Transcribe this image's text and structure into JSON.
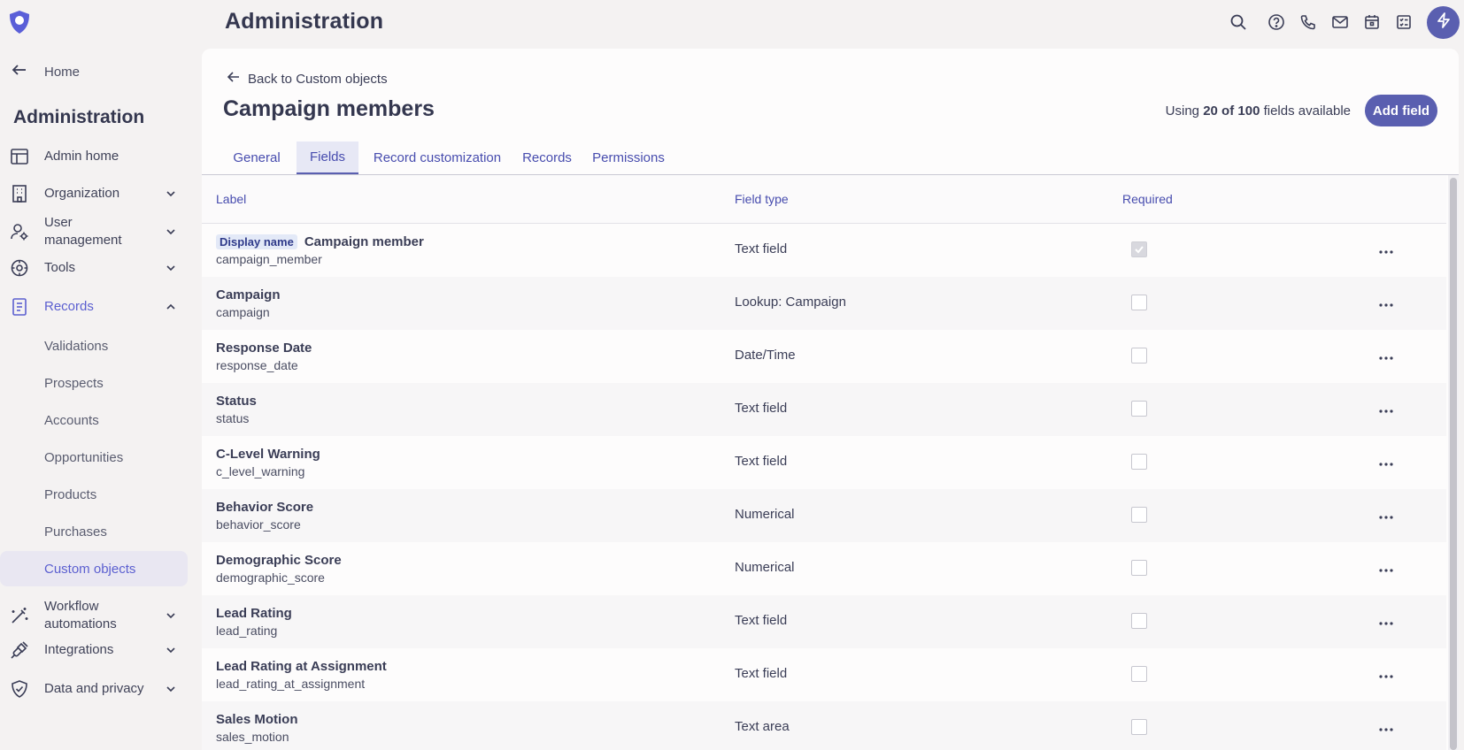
{
  "app": {
    "title": "Administration",
    "accent_color": "#5a5fb0",
    "top_icons": [
      "search-icon",
      "help-icon",
      "phone-icon",
      "mail-icon",
      "calendar-icon",
      "tasks-icon",
      "bolt-icon"
    ]
  },
  "sidebar": {
    "home_label": "Home",
    "heading": "Administration",
    "items": [
      {
        "label": "Admin home",
        "icon": "layout-icon"
      },
      {
        "label": "Organization",
        "icon": "building-icon"
      },
      {
        "label": "User management",
        "icon": "user-settings-icon"
      },
      {
        "label": "Tools",
        "icon": "tools-icon"
      },
      {
        "label": "Records",
        "icon": "records-icon"
      },
      {
        "label": "Workflow automations",
        "icon": "magic-wand-icon"
      },
      {
        "label": "Integrations",
        "icon": "plug-icon"
      },
      {
        "label": "Data and privacy",
        "icon": "shield-icon"
      }
    ],
    "records_sub": [
      "Validations",
      "Prospects",
      "Accounts",
      "Opportunities",
      "Products",
      "Purchases",
      "Custom objects"
    ],
    "selected_sub": "Custom objects"
  },
  "main": {
    "back_label": "Back to Custom objects",
    "title": "Campaign members",
    "usage_prefix": "Using",
    "usage_count": "20 of 100",
    "usage_suffix": "fields available",
    "add_button": "Add field",
    "tabs": [
      "General",
      "Fields",
      "Record customization",
      "Records",
      "Permissions"
    ],
    "active_tab": "Fields"
  },
  "table": {
    "headers": [
      "Label",
      "Field type",
      "Required"
    ],
    "rows": [
      {
        "badge": "Display name",
        "label": "Campaign member",
        "api": "campaign_member",
        "type": "Text field",
        "required": true
      },
      {
        "badge": "",
        "label": "Campaign",
        "api": "campaign",
        "type": "Lookup: Campaign",
        "required": false
      },
      {
        "badge": "",
        "label": "Response Date",
        "api": "response_date",
        "type": "Date/Time",
        "required": false
      },
      {
        "badge": "",
        "label": "Status",
        "api": "status",
        "type": "Text field",
        "required": false
      },
      {
        "badge": "",
        "label": "C-Level Warning",
        "api": "c_level_warning",
        "type": "Text field",
        "required": false
      },
      {
        "badge": "",
        "label": "Behavior Score",
        "api": "behavior_score",
        "type": "Numerical",
        "required": false
      },
      {
        "badge": "",
        "label": "Demographic Score",
        "api": "demographic_score",
        "type": "Numerical",
        "required": false
      },
      {
        "badge": "",
        "label": "Lead Rating",
        "api": "lead_rating",
        "type": "Text field",
        "required": false
      },
      {
        "badge": "",
        "label": "Lead Rating at Assignment",
        "api": "lead_rating_at_assignment",
        "type": "Text field",
        "required": false
      },
      {
        "badge": "",
        "label": "Sales Motion",
        "api": "sales_motion",
        "type": "Text area",
        "required": false
      }
    ]
  }
}
